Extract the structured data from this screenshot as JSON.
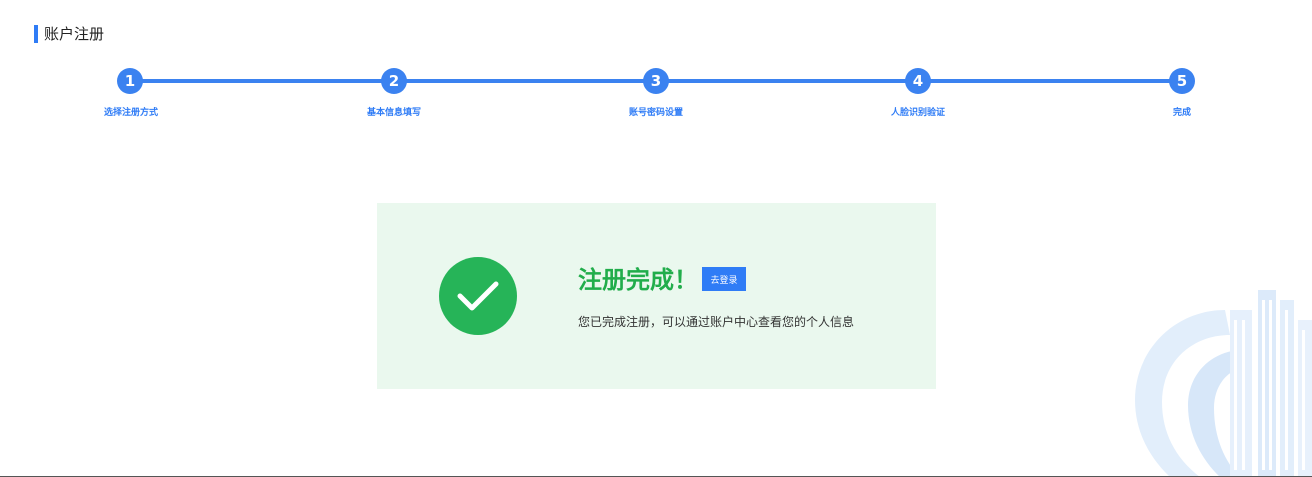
{
  "header": {
    "title": "账户注册"
  },
  "steps": [
    {
      "number": "1",
      "label": "选择注册方式"
    },
    {
      "number": "2",
      "label": "基本信息填写"
    },
    {
      "number": "3",
      "label": "账号密码设置"
    },
    {
      "number": "4",
      "label": "人脸识别验证"
    },
    {
      "number": "5",
      "label": "完成"
    }
  ],
  "result": {
    "title": "注册完成！",
    "login_button": "去登录",
    "description": "您已完成注册，可以通过账户中心查看您的个人信息"
  },
  "colors": {
    "accent": "#2f7cf6",
    "success": "#26b458",
    "panel_bg": "#eaf8ee"
  },
  "icons": {
    "success": "check-icon",
    "watermark": "building-emblem-icon"
  }
}
